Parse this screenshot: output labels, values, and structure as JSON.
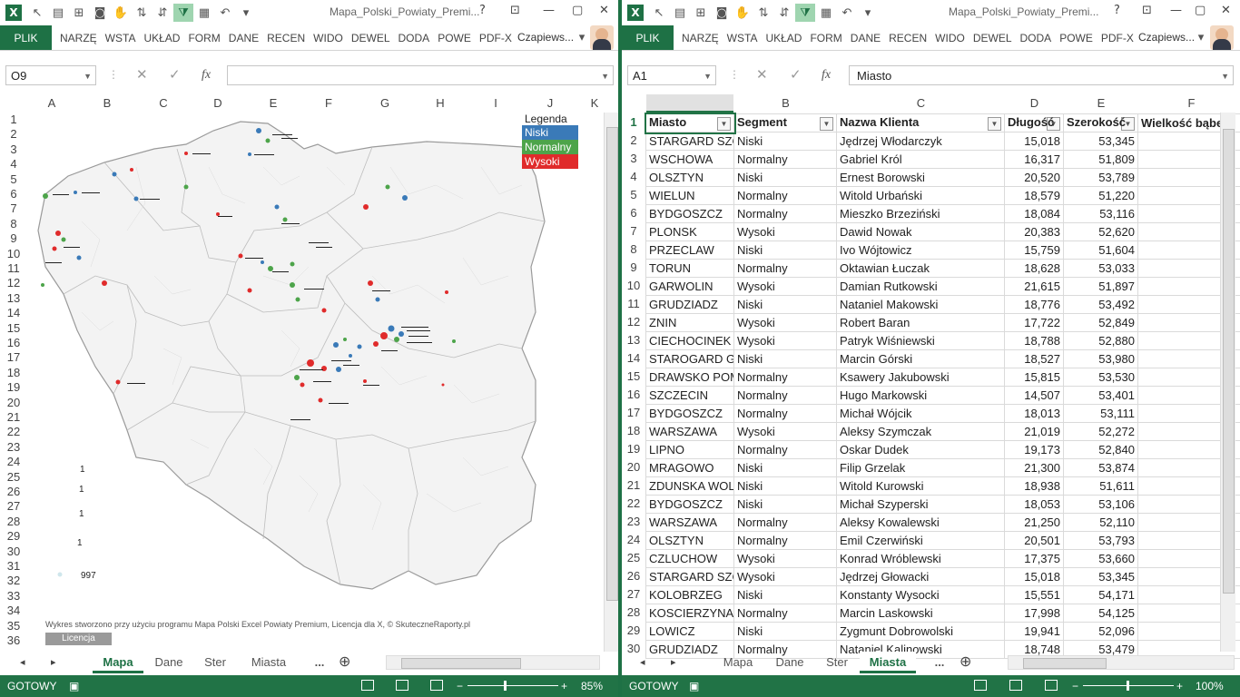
{
  "left": {
    "title": "Mapa_Polski_Powiaty_Premi...",
    "ribbon_file": "PLIK",
    "ribbon_tabs": [
      "NARZĘ",
      "WSTA",
      "UKŁAD",
      "FORM",
      "DANE",
      "RECEN",
      "WIDO",
      "DEWEL",
      "DODA",
      "POWE",
      "PDF-X"
    ],
    "user": "Czapiews...",
    "name_box": "O9",
    "formula": "",
    "columns": [
      "A",
      "B",
      "C",
      "D",
      "E",
      "F",
      "G",
      "H",
      "I",
      "J",
      "K"
    ],
    "rows": [
      "1",
      "2",
      "3",
      "4",
      "5",
      "6",
      "7",
      "8",
      "9",
      "10",
      "11",
      "12",
      "13",
      "14",
      "15",
      "16",
      "17",
      "18",
      "19",
      "20",
      "21",
      "22",
      "23",
      "24",
      "25",
      "26",
      "27",
      "28",
      "29",
      "30",
      "31",
      "32",
      "33",
      "34",
      "35",
      "36"
    ],
    "legend": {
      "title": "Legenda",
      "items": [
        {
          "label": "Niski",
          "color": "#3a7ab8"
        },
        {
          "label": "Normalny",
          "color": "#4da44a"
        },
        {
          "label": "Wysoki",
          "color": "#e02b2b"
        }
      ]
    },
    "size_legend": [
      "1",
      "1",
      "1",
      "1",
      "997"
    ],
    "footer": "Wykres stworzono przy użyciu programu Mapa Polski Excel Powiaty Premium, Licencja dla X, © SkuteczneRaporty.pl",
    "license_btn": "Licencja",
    "sheet_tabs": [
      "Mapa",
      "Dane",
      "Ster",
      "Miasta"
    ],
    "active_tab": "Mapa",
    "more_tabs": "...",
    "status": "GOTOWY",
    "zoom": "85%"
  },
  "right": {
    "title": "Mapa_Polski_Powiaty_Premi...",
    "ribbon_file": "PLIK",
    "ribbon_tabs": [
      "NARZĘ",
      "WSTA",
      "UKŁAD",
      "FORM",
      "DANE",
      "RECEN",
      "WIDO",
      "DEWEL",
      "DODA",
      "POWE",
      "PDF-X"
    ],
    "user": "Czapiews...",
    "name_box": "A1",
    "formula": "Miasto",
    "columns": [
      "A",
      "B",
      "C",
      "D",
      "E",
      "F"
    ],
    "headers": [
      "Miasto",
      "Segment",
      "Nazwa Klienta",
      "Długość",
      "Szerokość",
      "Wielkość bąbe"
    ],
    "rows": [
      [
        "STARGARD SZCZ",
        "Niski",
        "Jędrzej Włodarczyk",
        "15,018",
        "53,345"
      ],
      [
        "WSCHOWA",
        "Normalny",
        "Gabriel Król",
        "16,317",
        "51,809"
      ],
      [
        "OLSZTYN",
        "Niski",
        "Ernest Borowski",
        "20,520",
        "53,789"
      ],
      [
        "WIELUN",
        "Normalny",
        "Witold Urbański",
        "18,579",
        "51,220"
      ],
      [
        "BYDGOSZCZ",
        "Normalny",
        "Mieszko Brzeziński",
        "18,084",
        "53,116"
      ],
      [
        "PLONSK",
        "Wysoki",
        "Dawid Nowak",
        "20,383",
        "52,620"
      ],
      [
        "PRZECLAW",
        "Niski",
        "Ivo Wójtowicz",
        "15,759",
        "51,604"
      ],
      [
        "TORUN",
        "Normalny",
        "Oktawian Łuczak",
        "18,628",
        "53,033"
      ],
      [
        "GARWOLIN",
        "Wysoki",
        "Damian Rutkowski",
        "21,615",
        "51,897"
      ],
      [
        "GRUDZIADZ",
        "Niski",
        "Nataniel Makowski",
        "18,776",
        "53,492"
      ],
      [
        "ZNIN",
        "Wysoki",
        "Robert Baran",
        "17,722",
        "52,849"
      ],
      [
        "CIECHOCINEK",
        "Wysoki",
        "Patryk Wiśniewski",
        "18,788",
        "52,880"
      ],
      [
        "STAROGARD GD",
        "Niski",
        "Marcin Górski",
        "18,527",
        "53,980"
      ],
      [
        "DRAWSKO POM",
        "Normalny",
        "Ksawery Jakubowski",
        "15,815",
        "53,530"
      ],
      [
        "SZCZECIN",
        "Normalny",
        "Hugo Markowski",
        "14,507",
        "53,401"
      ],
      [
        "BYDGOSZCZ",
        "Normalny",
        "Michał Wójcik",
        "18,013",
        "53,111"
      ],
      [
        "WARSZAWA",
        "Wysoki",
        "Aleksy Szymczak",
        "21,019",
        "52,272"
      ],
      [
        "LIPNO",
        "Normalny",
        "Oskar Dudek",
        "19,173",
        "52,840"
      ],
      [
        "MRAGOWO",
        "Niski",
        "Filip Grzelak",
        "21,300",
        "53,874"
      ],
      [
        "ZDUNSKA WOLA",
        "Niski",
        "Witold Kurowski",
        "18,938",
        "51,611"
      ],
      [
        "BYDGOSZCZ",
        "Niski",
        "Michał Szyperski",
        "18,053",
        "53,106"
      ],
      [
        "WARSZAWA",
        "Normalny",
        "Aleksy Kowalewski",
        "21,250",
        "52,110"
      ],
      [
        "OLSZTYN",
        "Normalny",
        "Emil Czerwiński",
        "20,501",
        "53,793"
      ],
      [
        "CZLUCHOW",
        "Wysoki",
        "Konrad Wróblewski",
        "17,375",
        "53,660"
      ],
      [
        "STARGARD SZCZ",
        "Wysoki",
        "Jędrzej Głowacki",
        "15,018",
        "53,345"
      ],
      [
        "KOLOBRZEG",
        "Niski",
        "Konstanty Wysocki",
        "15,551",
        "54,171"
      ],
      [
        "KOSCIERZYNA",
        "Normalny",
        "Marcin Laskowski",
        "17,998",
        "54,125"
      ],
      [
        "LOWICZ",
        "Niski",
        "Zygmunt Dobrowolski",
        "19,941",
        "52,096"
      ],
      [
        "GRUDZIADZ",
        "Normalny",
        "Nataniel Kalinowski",
        "18,748",
        "53,479"
      ]
    ],
    "sheet_tabs": [
      "Mapa",
      "Dane",
      "Ster",
      "Miasta"
    ],
    "active_tab": "Miasta",
    "more_tabs": "...",
    "status": "GOTOWY",
    "zoom": "100%"
  }
}
